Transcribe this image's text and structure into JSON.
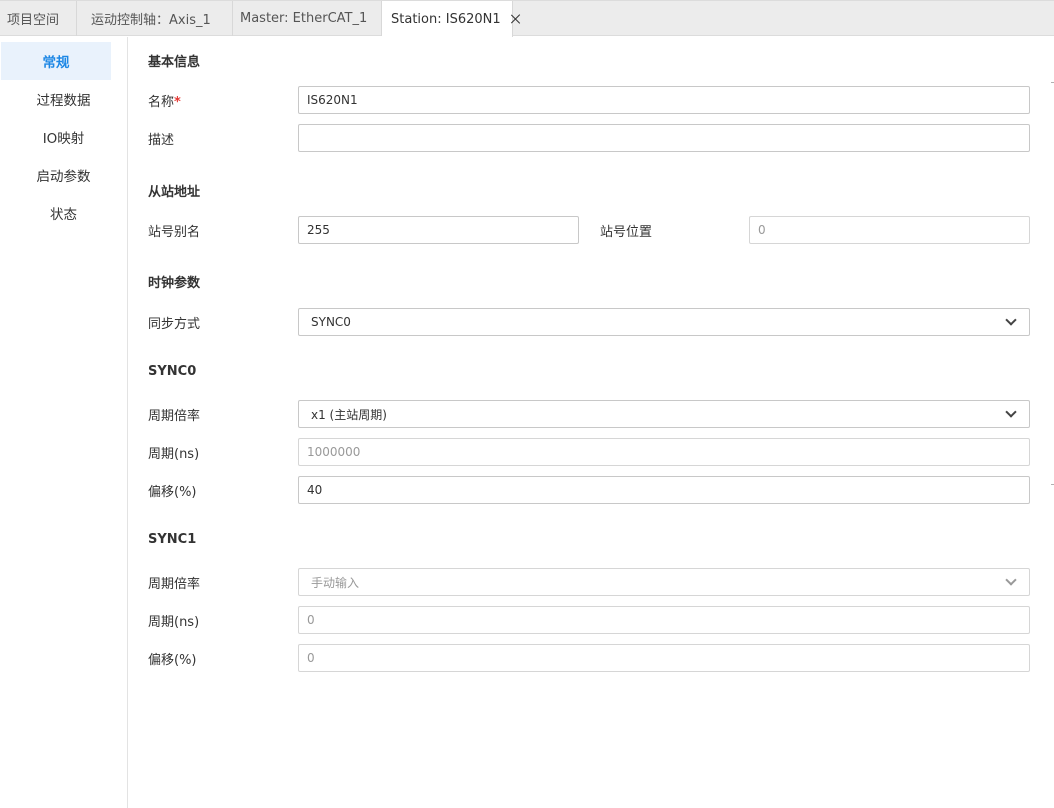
{
  "tabs": [
    {
      "label": "项目空间"
    },
    {
      "label": "运动控制轴：Axis_1"
    },
    {
      "label": "Master: EtherCAT_1"
    },
    {
      "label": "Station: IS620N1"
    }
  ],
  "sidebar": {
    "items": [
      {
        "label": "常规"
      },
      {
        "label": "过程数据"
      },
      {
        "label": "IO映射"
      },
      {
        "label": "启动参数"
      },
      {
        "label": "状态"
      }
    ]
  },
  "basic": {
    "title": "基本信息",
    "name_label": "名称",
    "required_mark": "*",
    "name_value": "IS620N1",
    "desc_label": "描述",
    "desc_value": ""
  },
  "address": {
    "title": "从站地址",
    "alias_label": "站号别名",
    "alias_value": "255",
    "position_label": "站号位置",
    "position_value": "0"
  },
  "clock": {
    "title": "时钟参数",
    "sync_mode_label": "同步方式",
    "sync_mode_value": "SYNC0"
  },
  "sync0": {
    "title": "SYNC0",
    "rate_label": "周期倍率",
    "rate_value": "x1 (主站周期)",
    "period_label": "周期(ns)",
    "period_value": "1000000",
    "offset_label": "偏移(%)",
    "offset_value": "40"
  },
  "sync1": {
    "title": "SYNC1",
    "rate_label": "周期倍率",
    "rate_value": "手动输入",
    "period_label": "周期(ns)",
    "period_value": "0",
    "offset_label": "偏移(%)",
    "offset_value": "0"
  },
  "colors": {
    "accent": "#1e88e5",
    "active_bg": "#e9f2fc",
    "required": "#e53935"
  }
}
